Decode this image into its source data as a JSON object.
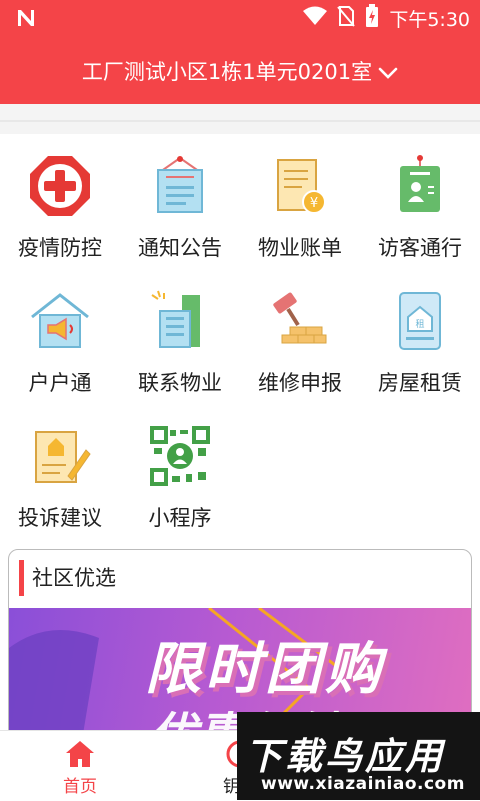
{
  "status_bar": {
    "time": "下午5:30"
  },
  "header": {
    "address": "工厂测试小区1栋1单元0201室"
  },
  "services": [
    {
      "label": "疫情防控",
      "icon": "medical-cross-icon"
    },
    {
      "label": "通知公告",
      "icon": "notice-board-icon"
    },
    {
      "label": "物业账单",
      "icon": "bill-icon"
    },
    {
      "label": "访客通行",
      "icon": "visitor-pass-icon"
    },
    {
      "label": "户户通",
      "icon": "home-broadcast-icon"
    },
    {
      "label": "联系物业",
      "icon": "property-building-icon"
    },
    {
      "label": "维修申报",
      "icon": "repair-hammer-icon"
    },
    {
      "label": "房屋租赁",
      "icon": "house-rental-icon"
    },
    {
      "label": "投诉建议",
      "icon": "complaint-note-icon"
    },
    {
      "label": "小程序",
      "icon": "mini-program-qr-icon"
    }
  ],
  "community": {
    "title": "社区优选",
    "banner_line1": "限时团购",
    "banner_line2": "优惠促销"
  },
  "tabs": [
    {
      "label": "首页",
      "icon": "home-icon",
      "active": true
    },
    {
      "label": "钥匙",
      "icon": "key-icon",
      "active": false
    }
  ],
  "watermark": {
    "title": "下载鸟应用",
    "url": "www.xiazainiao.com"
  },
  "colors": {
    "brand_red": "#f44448",
    "banner_purple": "#8a4fd8"
  }
}
